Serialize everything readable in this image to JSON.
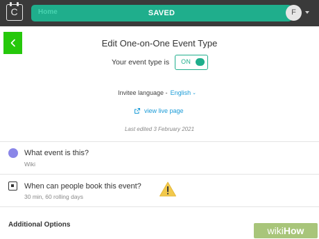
{
  "app": {
    "logo_letter": "C",
    "logo_icon": "calendar-logo-icon",
    "accent_color": "#1fae8c",
    "topbar_color": "#3a3a3a"
  },
  "toast": {
    "background_text": "Home",
    "message": "SAVED",
    "color": "#1fae8c"
  },
  "user": {
    "avatar_initial": "F",
    "menu_icon": "chevron-down-icon"
  },
  "header": {
    "back_icon": "chevron-left-icon",
    "back_highlight_color": "#26c80b",
    "title": "Edit One-on-One Event Type"
  },
  "event_type": {
    "label": "Your event type is",
    "toggle_text": "ON",
    "toggle_on": true
  },
  "language": {
    "label": "Invitee language -",
    "value": "English",
    "chevron_icon": "chevron-down-icon"
  },
  "live_page": {
    "icon": "external-link-icon",
    "label": "view live page"
  },
  "last_edited": "Last edited 3 February 2021",
  "sections": [
    {
      "icon": "purple-dot-icon",
      "title": "What event is this?",
      "subtitle": "Wiki"
    },
    {
      "icon": "calendar-icon",
      "title": "When can people book this event?",
      "subtitle": "30 min, 60 rolling days",
      "warning_icon": "warning-triangle-icon"
    }
  ],
  "additional_options": "Additional Options",
  "watermark": {
    "part1": "wiki",
    "part2": "How"
  }
}
